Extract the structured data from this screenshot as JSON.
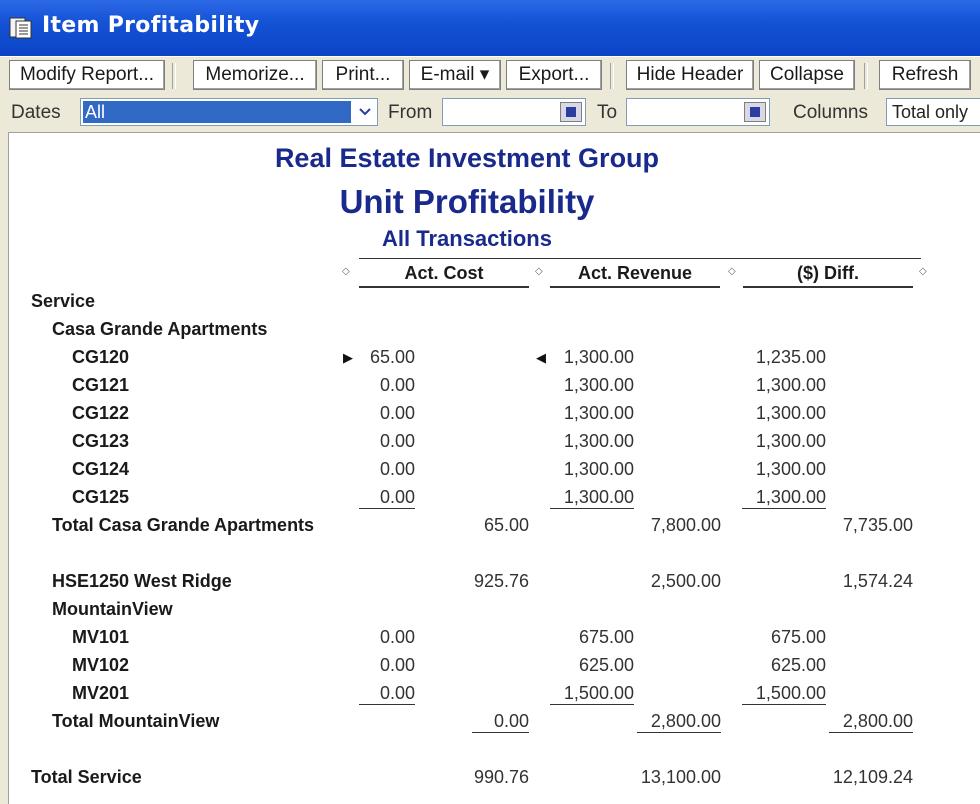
{
  "window": {
    "title": "Item Profitability"
  },
  "toolbar": {
    "modify": "Modify Report...",
    "memorize": "Memorize...",
    "print": "Print...",
    "email": "E-mail ▾",
    "export": "Export...",
    "hide_header": "Hide Header",
    "collapse": "Collapse",
    "refresh": "Refresh"
  },
  "filters": {
    "dates_label": "Dates",
    "dates_value": "All",
    "from_label": "From",
    "from_value": "",
    "to_label": "To",
    "to_value": "",
    "columns_label": "Columns",
    "columns_value": "Total only"
  },
  "report": {
    "company": "Real Estate Investment Group",
    "title": "Unit Profitability",
    "subtitle": "All Transactions",
    "columns": [
      "Act. Cost",
      "Act. Revenue",
      "($) Diff."
    ],
    "sections": {
      "service": "Service",
      "casa": "Casa Grande Apartments",
      "casa_total": "Total Casa Grande Apartments",
      "hse": "HSE1250 West Ridge",
      "mountain": "MountainView",
      "mountain_total": "Total MountainView",
      "service_total": "Total Service"
    },
    "casa_rows": [
      {
        "name": "CG120",
        "cost": "65.00",
        "revenue": "1,300.00",
        "diff": "1,235.00"
      },
      {
        "name": "CG121",
        "cost": "0.00",
        "revenue": "1,300.00",
        "diff": "1,300.00"
      },
      {
        "name": "CG122",
        "cost": "0.00",
        "revenue": "1,300.00",
        "diff": "1,300.00"
      },
      {
        "name": "CG123",
        "cost": "0.00",
        "revenue": "1,300.00",
        "diff": "1,300.00"
      },
      {
        "name": "CG124",
        "cost": "0.00",
        "revenue": "1,300.00",
        "diff": "1,300.00"
      },
      {
        "name": "CG125",
        "cost": "0.00",
        "revenue": "1,300.00",
        "diff": "1,300.00"
      }
    ],
    "casa_totals": {
      "cost": "65.00",
      "revenue": "7,800.00",
      "diff": "7,735.00"
    },
    "hse_totals": {
      "cost": "925.76",
      "revenue": "2,500.00",
      "diff": "1,574.24"
    },
    "mountain_rows": [
      {
        "name": "MV101",
        "cost": "0.00",
        "revenue": "675.00",
        "diff": "675.00"
      },
      {
        "name": "MV102",
        "cost": "0.00",
        "revenue": "625.00",
        "diff": "625.00"
      },
      {
        "name": "MV201",
        "cost": "0.00",
        "revenue": "1,500.00",
        "diff": "1,500.00"
      }
    ],
    "mountain_totals": {
      "cost": "0.00",
      "revenue": "2,800.00",
      "diff": "2,800.00"
    },
    "service_totals": {
      "cost": "990.76",
      "revenue": "13,100.00",
      "diff": "12,109.24"
    }
  }
}
